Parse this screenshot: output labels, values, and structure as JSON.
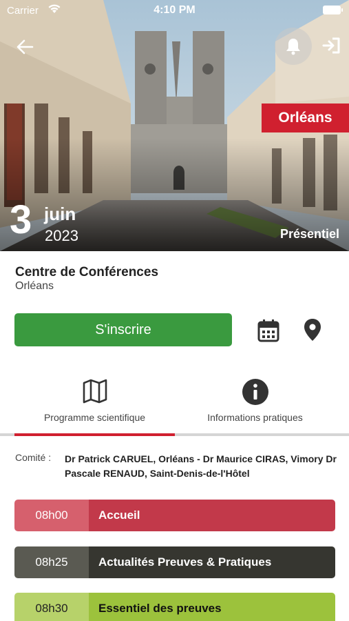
{
  "status_bar": {
    "carrier": "Carrier",
    "time": "4:10 PM"
  },
  "hero": {
    "city_badge": "Orléans",
    "date_day": "3",
    "date_month": "juin",
    "date_year": "2023",
    "mode": "Présentiel"
  },
  "event": {
    "venue": "Centre de Conférences",
    "city": "Orléans",
    "register_label": "S'inscrire"
  },
  "tabs": [
    {
      "label": "Programme scientifique",
      "icon": "map-icon",
      "active": true
    },
    {
      "label": "Informations pratiques",
      "icon": "info-icon",
      "active": false
    }
  ],
  "committee": {
    "label": "Comité :",
    "text": "Dr Patrick CARUEL, Orléans - Dr Maurice CIRAS, Vimory Dr Pascale RENAUD, Saint-Denis-de-l'Hôtel"
  },
  "schedule": [
    {
      "time": "08h00",
      "title": "Accueil"
    },
    {
      "time": "08h25",
      "title": "Actualités Preuves & Pratiques"
    },
    {
      "time": "08h30",
      "title": "Essentiel des preuves"
    }
  ],
  "colors": {
    "accent_red": "#d0202f",
    "register_green": "#3a9a3f"
  }
}
